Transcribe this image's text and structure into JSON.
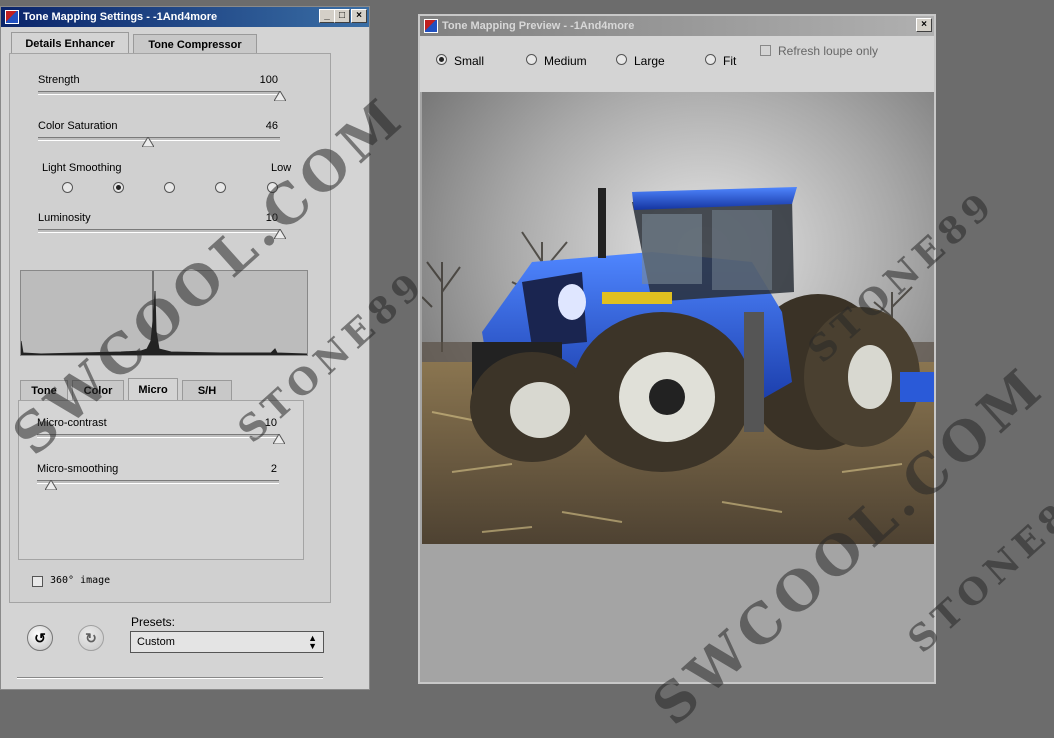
{
  "settings_window": {
    "title": "Tone Mapping Settings - -1And4more",
    "tabs": [
      "Details Enhancer",
      "Tone Compressor"
    ],
    "strength": {
      "label": "Strength",
      "value": "100",
      "fraction": 1.0
    },
    "color_saturation": {
      "label": "Color Saturation",
      "value": "46",
      "fraction": 0.46
    },
    "light_smoothing": {
      "label": "Light Smoothing",
      "end_label": "Low",
      "selected_index": 1,
      "count": 5
    },
    "luminosity": {
      "label": "Luminosity",
      "value": "10",
      "fraction": 1.0
    },
    "subtabs": [
      "Tone",
      "Color",
      "Micro",
      "S/H"
    ],
    "micro_contrast": {
      "label": "Micro-contrast",
      "value": "10",
      "fraction": 1.0
    },
    "micro_smoothing": {
      "label": "Micro-smoothing",
      "value": "2",
      "fraction": 0.06
    },
    "image360": {
      "label": "360° image",
      "checked": false
    },
    "presets": {
      "label": "Presets:",
      "value": "Custom"
    }
  },
  "preview_window": {
    "title": "Tone Mapping Preview - -1And4more",
    "sizes": [
      "Small",
      "Medium",
      "Large",
      "Fit"
    ],
    "selected_size": "Small",
    "refresh_loupe": {
      "label": "Refresh loupe only",
      "checked": false
    },
    "image_description": "tractor"
  },
  "watermarks": [
    "SWCOOL.COM",
    "STONE89"
  ],
  "colors": {
    "title_active": "#0a246a",
    "tractor_blue": "#1f4fd0",
    "panel": "#d4d4d4"
  }
}
